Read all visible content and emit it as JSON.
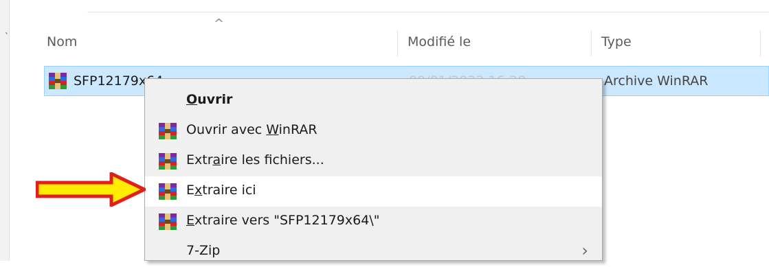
{
  "header": {
    "name": "Nom",
    "modified": "Modifié le",
    "type": "Type",
    "sort_icon": "chevron-up-icon"
  },
  "file_row": {
    "name": "SFP12179x64",
    "date": "09/01/2022 16:28",
    "type": "Archive WinRAR",
    "icon": "winrar-icon"
  },
  "context_menu": {
    "items": [
      {
        "label": "Ouvrir",
        "icon": ""
      },
      {
        "label": "Ouvrir avec WinRAR",
        "icon": "winrar-icon"
      },
      {
        "label": "Extraire les fichiers...",
        "icon": "winrar-icon"
      },
      {
        "label": "Extraire ici",
        "icon": "winrar-icon",
        "highlighted": true
      },
      {
        "label": "Extraire vers \"SFP12179x64\\\"",
        "icon": "winrar-icon"
      },
      {
        "label": "7-Zip",
        "icon": "",
        "submenu_icon": "chevron-right-icon"
      }
    ]
  },
  "annotation": {
    "icon": "red-yellow-arrow-icon",
    "fill": "#ffec00",
    "stroke": "#e0201a"
  },
  "colors": {
    "selection_bg": "#cce8ff",
    "selection_border": "#99d1ff",
    "menu_bg": "#f0f0f0",
    "menu_highlight": "#ffffff"
  }
}
